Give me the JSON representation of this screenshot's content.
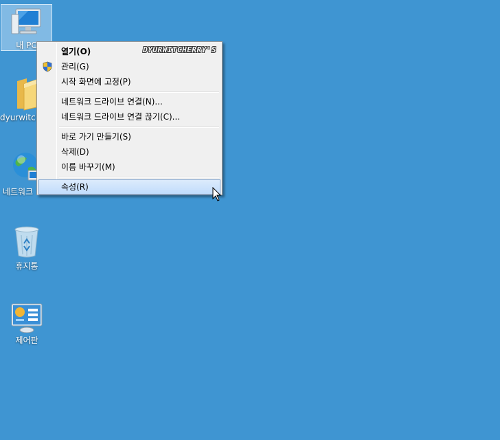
{
  "desktop": {
    "icons": [
      {
        "label": "내 PC",
        "icon": "computer-icon"
      },
      {
        "label": "dyurwitcherry",
        "icon": "folder-icon"
      },
      {
        "label": "네트워크",
        "icon": "network-globe-icon"
      },
      {
        "label": "휴지통",
        "icon": "recycle-bin-icon"
      },
      {
        "label": "제어판",
        "icon": "control-panel-icon"
      }
    ]
  },
  "context_menu": {
    "watermark": "DYURWITCHERRY'S",
    "groups": [
      [
        {
          "label": "열기(O)",
          "bold": true
        },
        {
          "label": "관리(G)",
          "icon": "uac-shield-icon"
        },
        {
          "label": "시작 화면에 고정(P)"
        }
      ],
      [
        {
          "label": "네트워크 드라이브 연결(N)..."
        },
        {
          "label": "네트워크 드라이브 연결 끊기(C)..."
        }
      ],
      [
        {
          "label": "바로 가기 만들기(S)"
        },
        {
          "label": "삭제(D)"
        },
        {
          "label": "이름 바꾸기(M)"
        }
      ],
      [
        {
          "label": "속성(R)",
          "highlighted": true
        }
      ]
    ]
  },
  "colors": {
    "desktop_background": "#3f95d2",
    "menu_background": "#f0f0f0",
    "highlight": "#c1dcfc"
  }
}
